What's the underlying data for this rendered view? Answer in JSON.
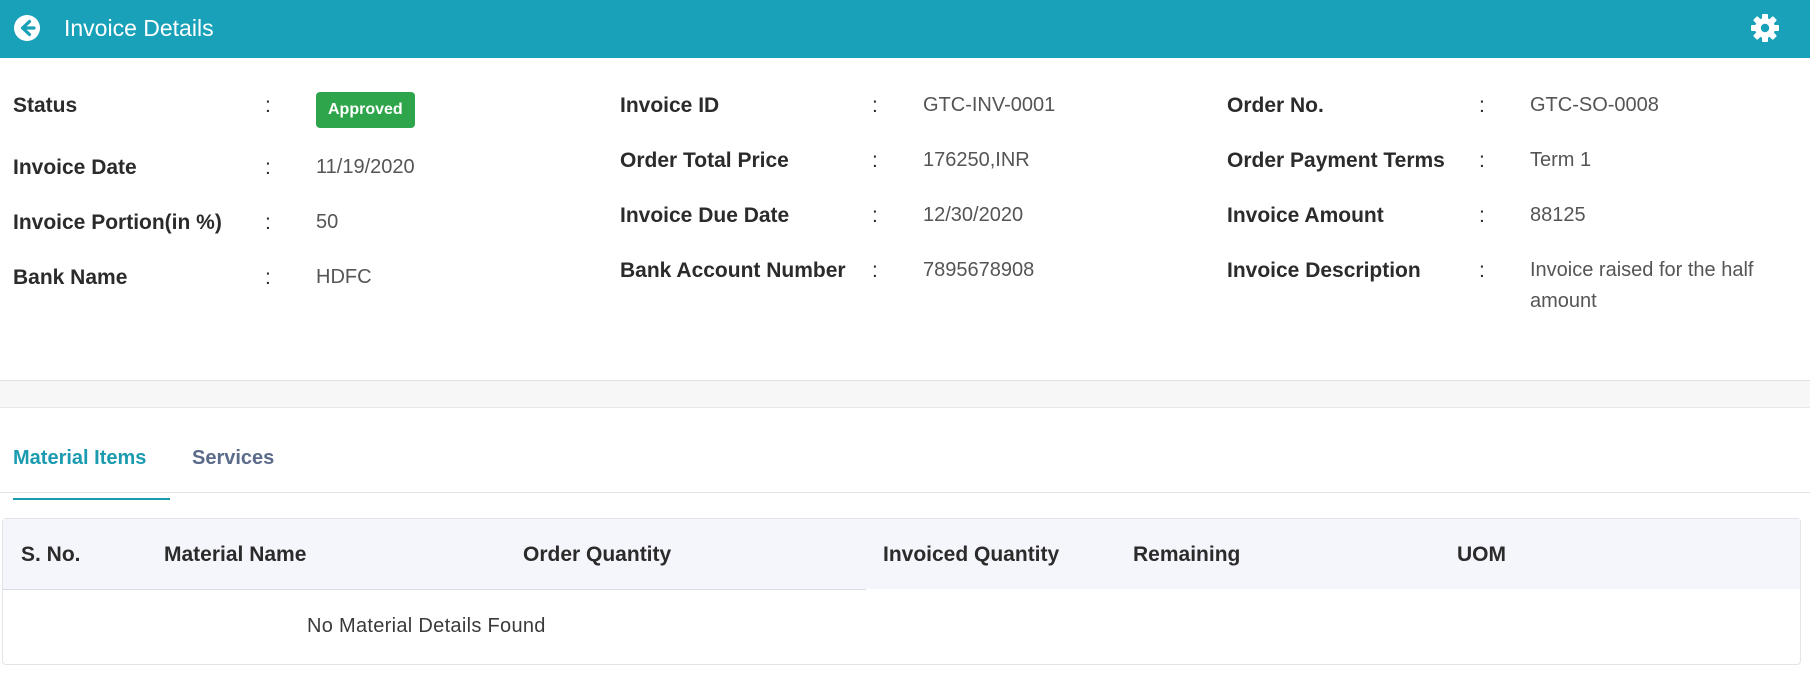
{
  "header": {
    "title": "Invoice Details",
    "color": "#18a1b8",
    "back_icon": "arrow-left-circle-icon",
    "settings_icon": "gear-icon"
  },
  "details": {
    "column1": [
      {
        "label": "Status",
        "value": "Approved",
        "type": "badge"
      },
      {
        "label": "Invoice Date",
        "value": "11/19/2020"
      },
      {
        "label": "Invoice Portion(in %)",
        "value": "50"
      },
      {
        "label": "Bank Name",
        "value": "HDFC"
      }
    ],
    "column2": [
      {
        "label": "Invoice ID",
        "value": "GTC-INV-0001"
      },
      {
        "label": "Order Total Price",
        "value": "176250,INR"
      },
      {
        "label": "Invoice Due Date",
        "value": "12/30/2020"
      },
      {
        "label": "Bank Account Number",
        "value": "7895678908"
      }
    ],
    "column3": [
      {
        "label": "Order No.",
        "value": "GTC-SO-0008"
      },
      {
        "label": "Order Payment Terms",
        "value": "Term 1"
      },
      {
        "label": "Invoice Amount",
        "value": "88125"
      },
      {
        "label": "Invoice Description",
        "value": "Invoice raised for the half amount"
      }
    ],
    "separator": ":",
    "badge_color": "#2ea54a"
  },
  "tabs": [
    {
      "label": "Material Items",
      "active": true
    },
    {
      "label": "Services",
      "active": false
    }
  ],
  "table": {
    "headers": [
      "S. No.",
      "Material Name",
      "Order Quantity",
      "Invoiced Quantity",
      "Remaining",
      "UOM"
    ],
    "empty_message": "No Material Details Found"
  }
}
